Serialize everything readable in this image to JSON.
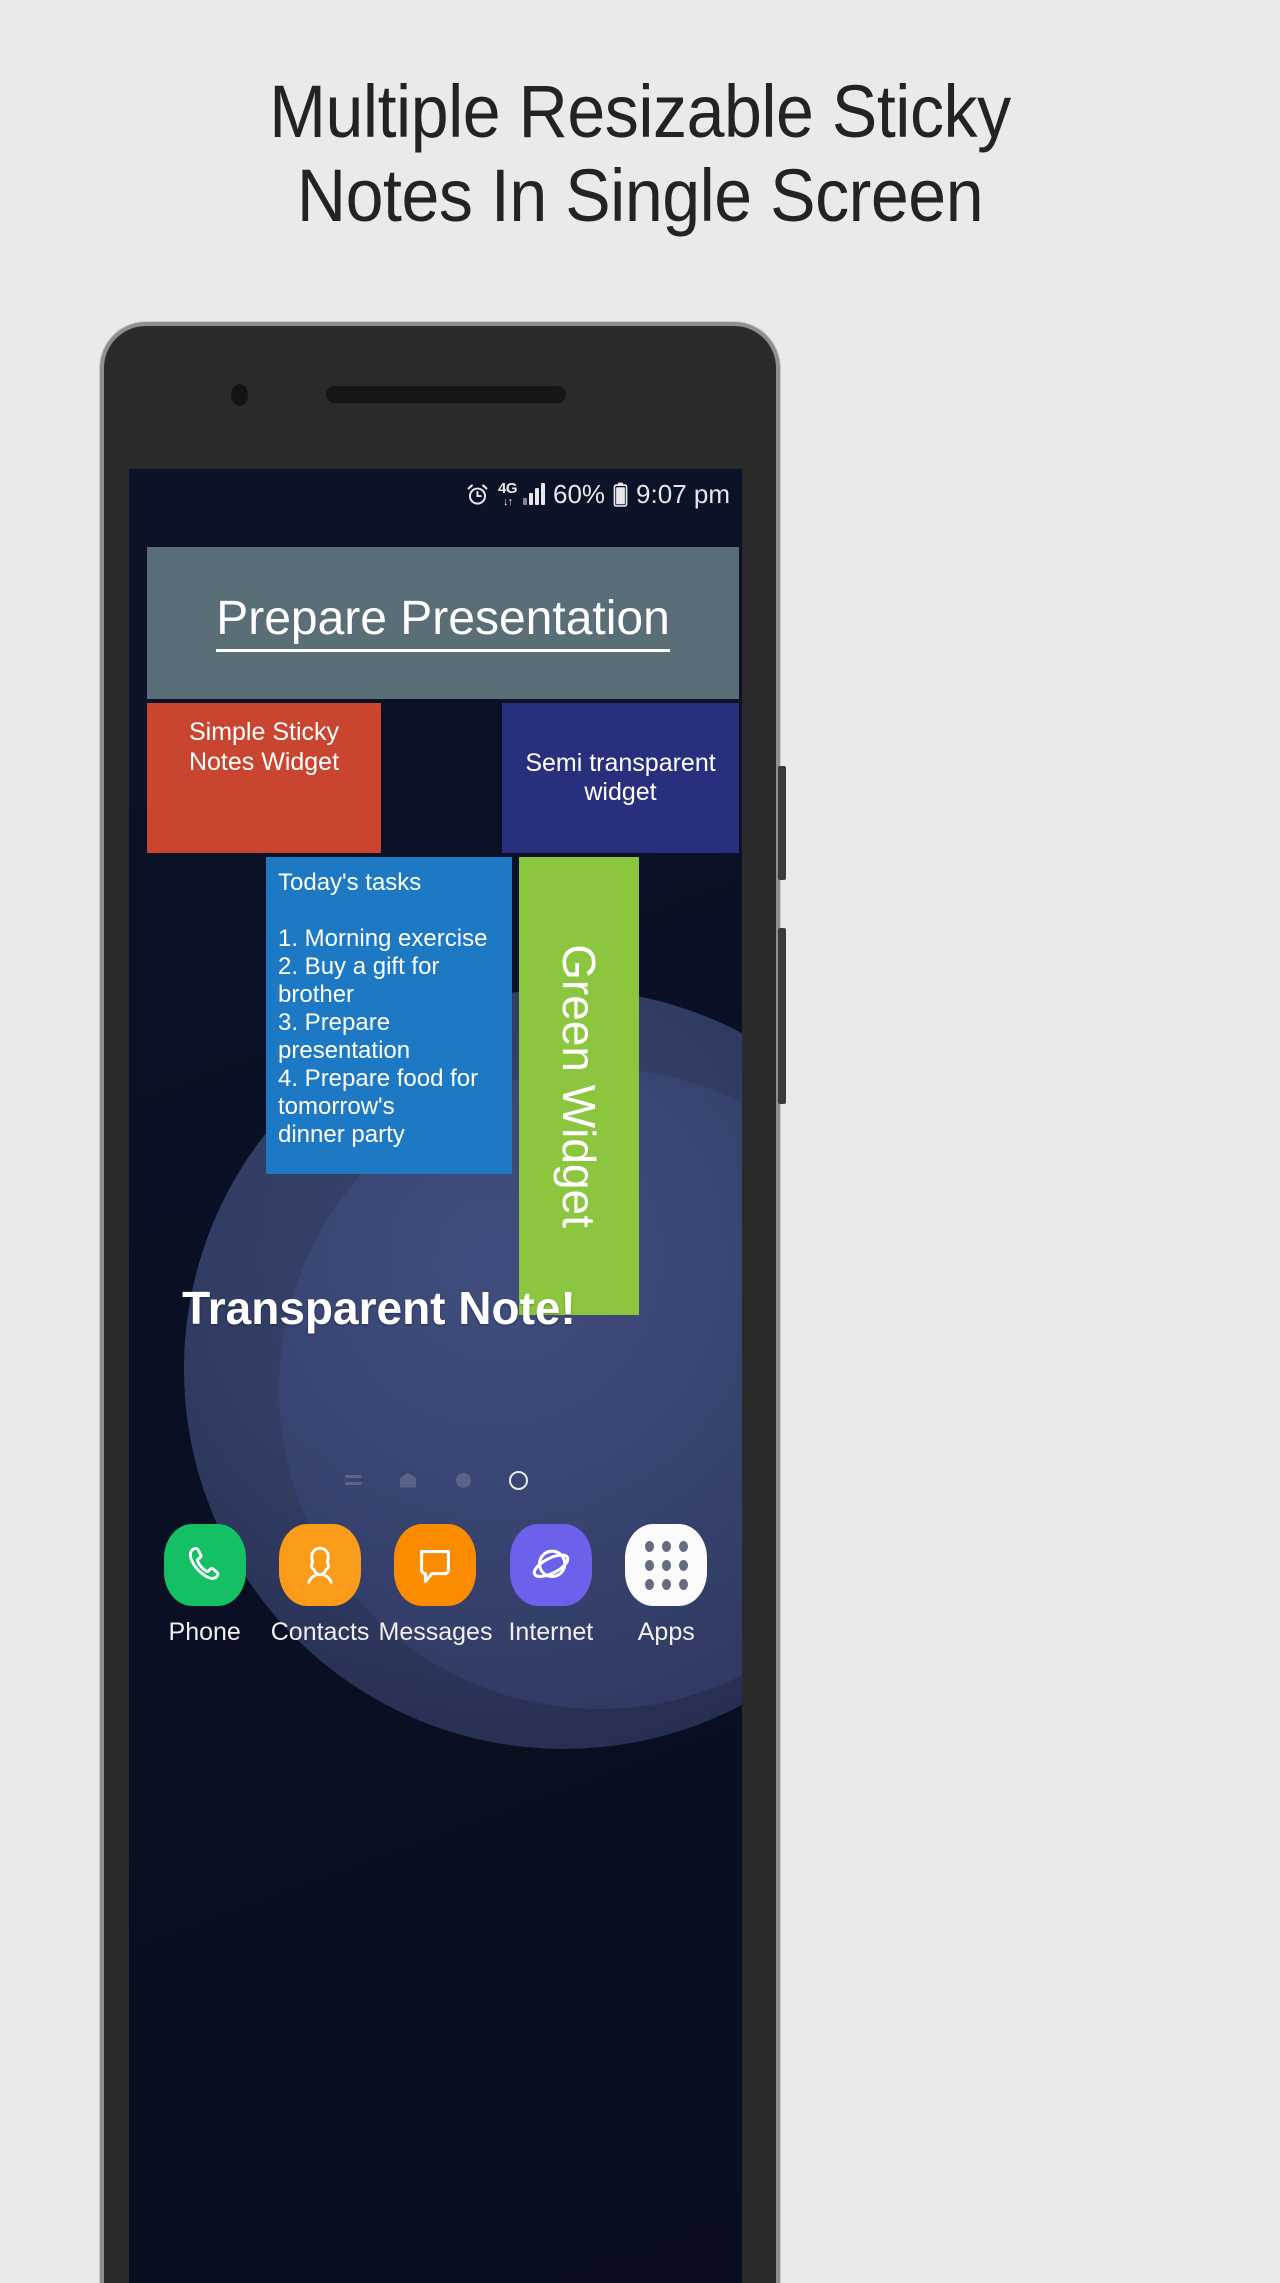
{
  "headline": {
    "line1": "Multiple Resizable Sticky",
    "line2": "Notes In Single Screen"
  },
  "colors": {
    "page_background": "#eaeaec",
    "headline_text": "#232323",
    "phone_body": "#2a2a2a",
    "phone_frame": "#8f8f8f",
    "wallpaper_dark": "#0b1027",
    "wallpaper_blob": "#3d4a77",
    "title_widget": "#5a6e78",
    "red_widget": "#c9452f",
    "semitransparent_widget": "#2d348c",
    "tasks_widget": "#1d79c4",
    "green_widget": "#8cc63e",
    "phone_icon": "#14c064",
    "contacts_icon": "#fb9b1a",
    "messages_icon": "#fb8c00",
    "internet_icon": "#6b61ea",
    "apps_icon": "#fbfbfb"
  },
  "statusbar": {
    "alarm_icon": "alarm-clock-icon",
    "network_label": "4G",
    "network_arrows": "↓↑",
    "signal_icon": "signal-bars-icon",
    "battery_percent": "60%",
    "battery_icon": "battery-icon",
    "clock": "9:07 pm"
  },
  "widgets": {
    "title_note": {
      "text": "Prepare Presentation"
    },
    "red_note": {
      "text": "Simple Sticky\nNotes Widget"
    },
    "semitransparent_note": {
      "text": "Semi transparent widget"
    },
    "tasks_note": {
      "text": "Today's tasks\n\n1. Morning exercise\n2. Buy a gift for brother\n3. Prepare presentation\n4. Prepare food for tomorrow's\ndinner party"
    },
    "green_note": {
      "text": "Green Widget"
    },
    "transparent_note": {
      "text": "Transparent Note!"
    }
  },
  "page_indicator": {
    "items": [
      {
        "name": "lines",
        "active": false
      },
      {
        "name": "home",
        "active": false
      },
      {
        "name": "dot",
        "active": false
      },
      {
        "name": "ring",
        "active": true
      }
    ]
  },
  "dock": {
    "items": [
      {
        "label": "Phone",
        "icon": "phone-icon"
      },
      {
        "label": "Contacts",
        "icon": "contacts-icon"
      },
      {
        "label": "Messages",
        "icon": "messages-icon"
      },
      {
        "label": "Internet",
        "icon": "internet-icon"
      },
      {
        "label": "Apps",
        "icon": "apps-grid-icon"
      }
    ]
  }
}
